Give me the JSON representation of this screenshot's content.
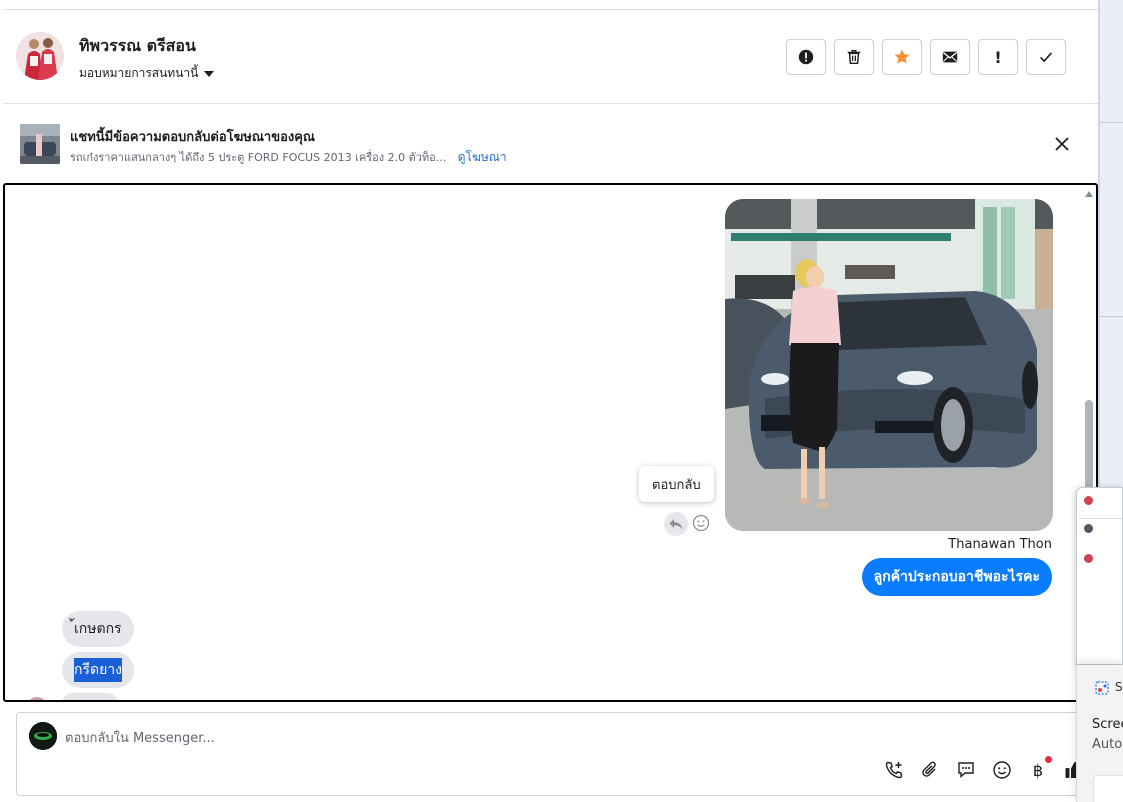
{
  "header": {
    "contact_name": "ทิพวรรณ ตรีสอน",
    "assign_label": "มอบหมายการสนทนานี้",
    "actions": [
      {
        "name": "spam-icon"
      },
      {
        "name": "trash-icon"
      },
      {
        "name": "star-icon"
      },
      {
        "name": "envelope-icon"
      },
      {
        "name": "follow-up-icon",
        "glyph": "!"
      },
      {
        "name": "done-icon"
      }
    ],
    "star_color": "#f7923b"
  },
  "ad_banner": {
    "title": "แชทนี้มีข้อความตอบกลับต่อโฆษณาของคุณ",
    "description": "รถเก๋งราคาแสนกลางๆ ได้ถึง 5 ประตู FORD FOCUS 2013 เครื่อง 2.0 ตัวท็อ...",
    "link_label": "ดูโฆษณา"
  },
  "conversation": {
    "tooltip_label": "ตอบกลับ",
    "sender_name": "Thanawan Thon",
    "outgoing_message": "ลูกค้าประกอบอาชีพอะไรคะ",
    "incoming_messages": [
      "้เกษตกร",
      "กรีดยาง"
    ],
    "outgoing_color": "#0a7cff"
  },
  "composer": {
    "placeholder": "ตอบกลับใน Messenger...",
    "tools": [
      "call-add-icon",
      "attachment-icon",
      "saved-reply-icon",
      "emoji-icon",
      "baht-payment-icon",
      "like-icon"
    ],
    "baht_glyph": "฿"
  },
  "side_panel": {
    "app_initial": "S",
    "title": "Scree",
    "subtitle": "Auto"
  }
}
